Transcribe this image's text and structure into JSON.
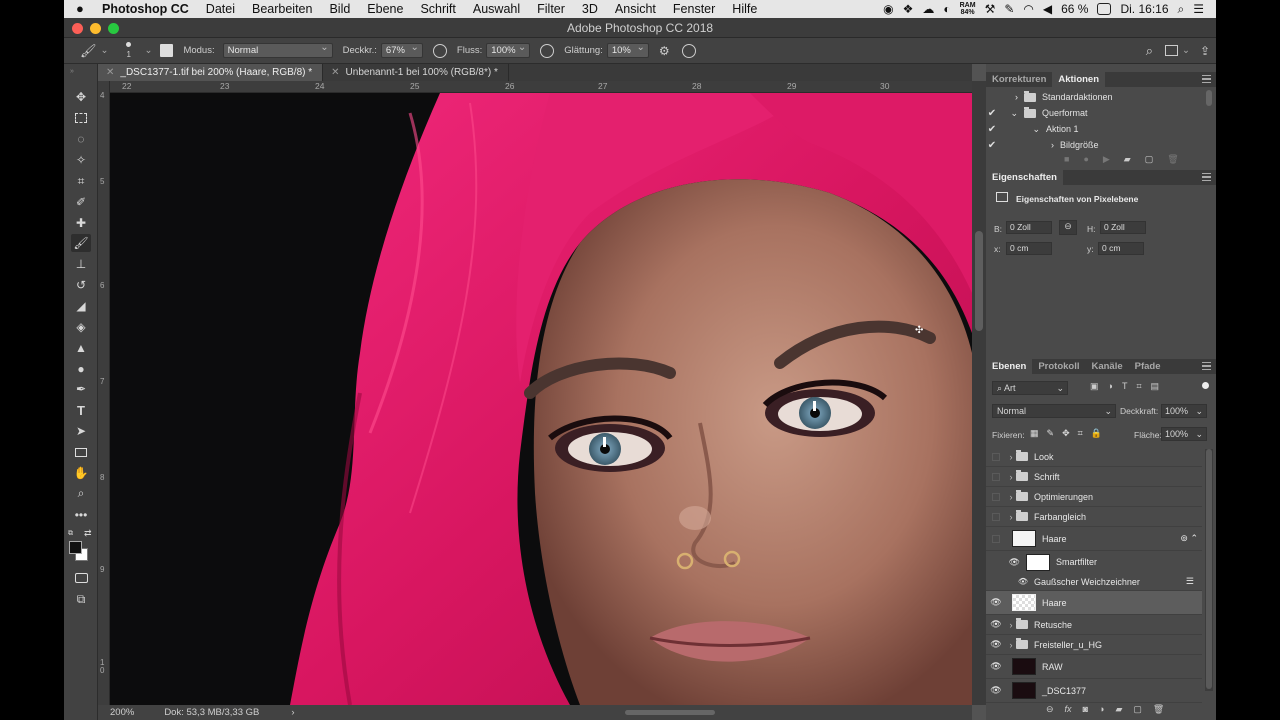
{
  "menubar": {
    "app": "Photoshop CC",
    "items": [
      "Datei",
      "Bearbeiten",
      "Bild",
      "Ebene",
      "Schrift",
      "Auswahl",
      "Filter",
      "3D",
      "Ansicht",
      "Fenster",
      "Hilfe"
    ],
    "ram_label": "RAM",
    "ram_value": "84%",
    "battery": "66 %",
    "clock": "Di. 16:16"
  },
  "window": {
    "title": "Adobe Photoshop CC 2018"
  },
  "options": {
    "brush_size": "1",
    "mode_label": "Modus:",
    "mode_value": "Normal",
    "opacity_label": "Deckkr.:",
    "opacity_value": "67%",
    "flow_label": "Fluss:",
    "flow_value": "100%",
    "smoothing_label": "Glättung:",
    "smoothing_value": "10%"
  },
  "tabs": [
    {
      "label": "_DSC1377-1.tif bei 200% (Haare, RGB/8) *"
    },
    {
      "label": "Unbenannt-1 bei 100% (RGB/8*) *"
    }
  ],
  "ruler_h": [
    "22",
    "23",
    "24",
    "25",
    "26",
    "27",
    "28",
    "29",
    "30"
  ],
  "ruler_v": [
    "4",
    "5",
    "6",
    "7",
    "8",
    "9",
    "1\n0"
  ],
  "status": {
    "zoom": "200%",
    "doc": "Dok: 53,3 MB/3,33 GB"
  },
  "actions_panel": {
    "tabs": [
      "Korrekturen",
      "Aktionen"
    ],
    "rows": [
      {
        "label": "Standardaktionen",
        "checked": false
      },
      {
        "label": "Querformat",
        "checked": true
      },
      {
        "label": "Aktion 1",
        "checked": true
      },
      {
        "label": "Bildgröße",
        "checked": true
      }
    ]
  },
  "properties": {
    "title": "Eigenschaften",
    "subtitle": "Eigenschaften von Pixelebene",
    "b_label": "B:",
    "b_value": "0 Zoll",
    "h_label": "H:",
    "h_value": "0 Zoll",
    "x_label": "x:",
    "x_value": "0 cm",
    "y_label": "y:",
    "y_value": "0 cm"
  },
  "layers_panel": {
    "tabs": [
      "Ebenen",
      "Protokoll",
      "Kanäle",
      "Pfade"
    ],
    "filter_kind": "Art",
    "blend_mode": "Normal",
    "opacity_label": "Deckkraft:",
    "opacity_value": "100%",
    "lock_label": "Fixieren:",
    "fill_label": "Fläche:",
    "fill_value": "100%",
    "layers": [
      {
        "name": "Look",
        "type": "group",
        "visible": false
      },
      {
        "name": "Schrift",
        "type": "group",
        "visible": false
      },
      {
        "name": "Optimierungen",
        "type": "group",
        "visible": false
      },
      {
        "name": "Farbangleich",
        "type": "group",
        "visible": false
      },
      {
        "name": "Haare",
        "type": "smart",
        "visible": false
      },
      {
        "name": "Smartfilter",
        "type": "smartfilter",
        "visible": true
      },
      {
        "name": "Gaußscher Weichzeichner",
        "type": "filter",
        "visible": true
      },
      {
        "name": "Haare",
        "type": "pixel",
        "visible": true
      },
      {
        "name": "Retusche",
        "type": "group",
        "visible": true
      },
      {
        "name": "Freisteller_u_HG",
        "type": "group",
        "visible": true
      },
      {
        "name": "RAW",
        "type": "pixel",
        "visible": true
      },
      {
        "name": "_DSC1377",
        "type": "pixel",
        "visible": true
      }
    ]
  },
  "colors": {
    "accent_hair": "#e8236c",
    "panel_bg": "#4a4a4a",
    "selected_layer": "#5d5d5d"
  }
}
